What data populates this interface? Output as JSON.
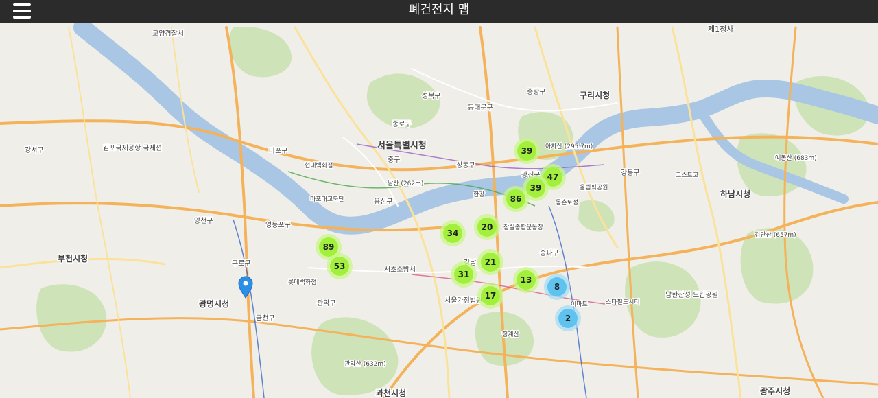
{
  "header": {
    "title": "폐건전지 맵"
  },
  "map": {
    "place_labels": {
      "seoul_city_hall": "서울특별시청",
      "guri_city_hall": "구리시청",
      "hanam_city_hall": "하남시청",
      "bucheon_city_hall": "부천시청",
      "gwangmyeong_city_hall": "광명시청",
      "gwacheon_city_hall": "과천시청",
      "gwangju_city_hall": "광주시청",
      "goyang": "고양경찰서",
      "mapo": "마포구",
      "yongsan": "용산구",
      "seongdong": "성동구",
      "gwangjin": "광진구",
      "gangdong": "강동구",
      "gangnam": "강남",
      "songpa": "송파구",
      "gangseo": "강서구",
      "yangcheon": "양천구",
      "yeongdeungpo": "영등포구",
      "guro": "구로구",
      "geumcheon": "금천구",
      "gwanak": "관악구",
      "seocho_fire": "서초소방서",
      "seoul_family_court": "서울가정법원",
      "jung": "중구",
      "jongno": "종로구",
      "dongdaemun": "동대문구",
      "seongbuk": "성북구",
      "jungnang": "중랑구",
      "gimpo_airport": "김포국제공항 국제선",
      "namsan": "남산 (262m)",
      "achasan": "아차산 (295.7m)",
      "gwanaksan": "관악산 (632m)",
      "cheonggyesan": "청계산",
      "namhansanseong": "남한산성 도립공원",
      "yebongsan": "예봉산 (683m)",
      "geomdansan": "검단산 (657m)",
      "hangang": "한강",
      "je1_bridge": "제1청사",
      "mongchon": "몽촌토성",
      "jamsil": "잠실종합운동장",
      "olympic": "올림픽공원",
      "starfield": "스타필드시티",
      "emart": "이마트",
      "costco": "코스트코",
      "lotte": "롯데백화점",
      "hyundai": "현대백화점",
      "mapo_market": "마포대교북단"
    },
    "marker": {
      "icon": "map-pin-icon",
      "color": "#2b8fe8"
    },
    "cluster_colors": {
      "green": "#a3f03c",
      "green_halo": "#c8f786",
      "blue": "#5fc3f0",
      "blue_halo": "#a6dcf5"
    },
    "clusters": [
      {
        "count": "39",
        "color": "green"
      },
      {
        "count": "47",
        "color": "green"
      },
      {
        "count": "39",
        "color": "green"
      },
      {
        "count": "86",
        "color": "green"
      },
      {
        "count": "20",
        "color": "green"
      },
      {
        "count": "34",
        "color": "green"
      },
      {
        "count": "89",
        "color": "green"
      },
      {
        "count": "53",
        "color": "green"
      },
      {
        "count": "21",
        "color": "green"
      },
      {
        "count": "31",
        "color": "green"
      },
      {
        "count": "13",
        "color": "green"
      },
      {
        "count": "17",
        "color": "green"
      },
      {
        "count": "8",
        "color": "blue"
      },
      {
        "count": "2",
        "color": "blue"
      }
    ]
  }
}
